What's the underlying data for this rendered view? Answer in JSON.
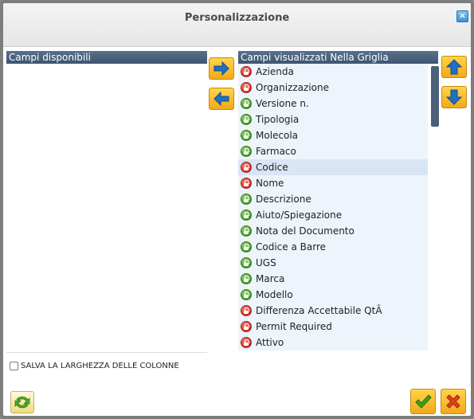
{
  "dialog": {
    "title": "Personalizzazione",
    "close_label": "×"
  },
  "available": {
    "header": "Campi disponibili",
    "items": []
  },
  "visible": {
    "header": "Campi visualizzati Nella Griglia",
    "items": [
      {
        "label": "Azienda",
        "lock": "red",
        "selected": false
      },
      {
        "label": "Organizzazione",
        "lock": "red",
        "selected": false
      },
      {
        "label": "Versione n.",
        "lock": "green",
        "selected": false
      },
      {
        "label": "Tipologia",
        "lock": "green",
        "selected": false
      },
      {
        "label": "Molecola",
        "lock": "green",
        "selected": false
      },
      {
        "label": "Farmaco",
        "lock": "green",
        "selected": false
      },
      {
        "label": "Codice",
        "lock": "red",
        "selected": true
      },
      {
        "label": "Nome",
        "lock": "red",
        "selected": false
      },
      {
        "label": "Descrizione",
        "lock": "green",
        "selected": false
      },
      {
        "label": "Aiuto/Spiegazione",
        "lock": "green",
        "selected": false
      },
      {
        "label": "Nota del Documento",
        "lock": "green",
        "selected": false
      },
      {
        "label": "Codice a Barre",
        "lock": "green",
        "selected": false
      },
      {
        "label": "UGS",
        "lock": "green",
        "selected": false
      },
      {
        "label": "Marca",
        "lock": "green",
        "selected": false
      },
      {
        "label": "Modello",
        "lock": "green",
        "selected": false
      },
      {
        "label": "Differenza Accettabile QtÃ",
        "lock": "red",
        "selected": false
      },
      {
        "label": "Permit Required",
        "lock": "red",
        "selected": false
      },
      {
        "label": "Attivo",
        "lock": "red",
        "selected": false
      }
    ]
  },
  "options": {
    "save_widths_label": "SALVA LA LARGHEZZA DELLE COLONNE",
    "save_widths_checked": false
  },
  "icons": {
    "move_right": "arrow-right-icon",
    "move_left": "arrow-left-icon",
    "move_up": "arrow-up-icon",
    "move_down": "arrow-down-icon",
    "refresh": "refresh-icon",
    "ok": "check-icon",
    "cancel": "x-icon"
  },
  "colors": {
    "header_bg": "#4b6078",
    "row_bg": "#eef4fb",
    "selected_bg": "#d9e4f5",
    "button_yellow": "#f3b52a",
    "arrow_blue": "#1f6fc2"
  }
}
